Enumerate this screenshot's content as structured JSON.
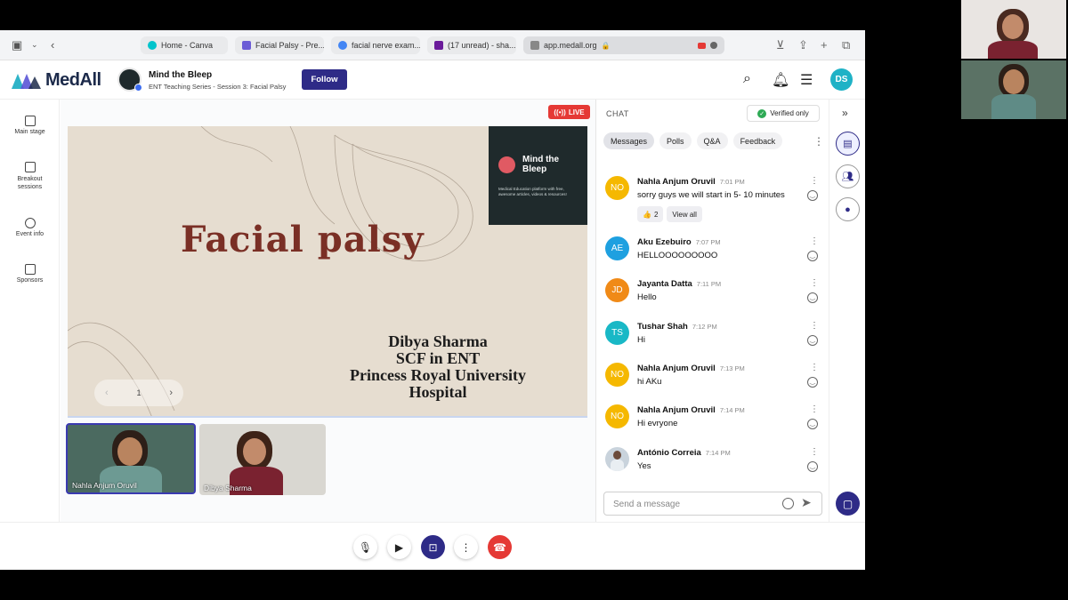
{
  "browser": {
    "tabs": [
      {
        "label": "Home - Canva",
        "favicon_color": "#00c4cc"
      },
      {
        "label": "Facial Palsy - Pre...",
        "favicon_color": "#6b5cd6"
      },
      {
        "label": "facial nerve exam...",
        "favicon_color": "#4285f4"
      },
      {
        "label": "(17 unread) - sha...",
        "favicon_color": "#6a1b9a"
      },
      {
        "label": "app.medall.org",
        "favicon_color": "#888888"
      }
    ]
  },
  "header": {
    "brand": "MedAll",
    "series_title": "Mind the Bleep",
    "series_subtitle": "ENT Teaching Series - Session 3: Facial Palsy",
    "follow_label": "Follow",
    "user_initials": "DS"
  },
  "leftnav": {
    "items": [
      {
        "label": "Main stage"
      },
      {
        "label": "Breakout sessions"
      },
      {
        "label": "Event info"
      },
      {
        "label": "Sponsors"
      }
    ]
  },
  "stage": {
    "live_label": "LIVE",
    "slide": {
      "title": "Facial palsy",
      "author_lines": [
        "Dibya Sharma",
        "SCF in ENT",
        "Princess Royal University",
        "Hospital"
      ],
      "card_title": "Mind the Bleep",
      "card_subtitle": "Medical Education platform with free, awesome articles, videos & resources!"
    },
    "page_number": "1",
    "participants": [
      {
        "name": "Nahla Anjum Oruvil"
      },
      {
        "name": "Dibya Sharma"
      }
    ]
  },
  "chat": {
    "label": "CHAT",
    "verified_label": "Verified only",
    "tabs": [
      {
        "label": "Messages"
      },
      {
        "label": "Polls"
      },
      {
        "label": "Q&A"
      },
      {
        "label": "Feedback"
      }
    ],
    "messages": [
      {
        "initials": "NO",
        "color": "#f5b800",
        "author": "Nahla Anjum Oruvil",
        "time": "7:01 PM",
        "text": "sorry guys we will start in 5- 10 minutes",
        "reaction_count": "2",
        "view_all": "View all"
      },
      {
        "initials": "AE",
        "color": "#1ea0e0",
        "author": "Aku Ezebuiro",
        "time": "7:07 PM",
        "text": "HELLOOOOOOOOO"
      },
      {
        "initials": "JD",
        "color": "#f08a17",
        "author": "Jayanta Datta",
        "time": "7:11 PM",
        "text": "Hello"
      },
      {
        "initials": "TS",
        "color": "#19b8c6",
        "author": "Tushar Shah",
        "time": "7:12 PM",
        "text": "Hi"
      },
      {
        "initials": "NO",
        "color": "#f5b800",
        "author": "Nahla Anjum Oruvil",
        "time": "7:13 PM",
        "text": "hi AKu"
      },
      {
        "initials": "NO",
        "color": "#f5b800",
        "author": "Nahla Anjum Oruvil",
        "time": "7:14 PM",
        "text": "Hi evryone"
      },
      {
        "initials": "",
        "color": "#c9d3dc",
        "author": "António Correia",
        "time": "7:14 PM",
        "text": "Yes"
      }
    ],
    "input_placeholder": "Send a message"
  },
  "colors": {
    "accent": "#2e2b87",
    "live_red": "#e53935",
    "brand_teal": "#1fb2c6"
  }
}
